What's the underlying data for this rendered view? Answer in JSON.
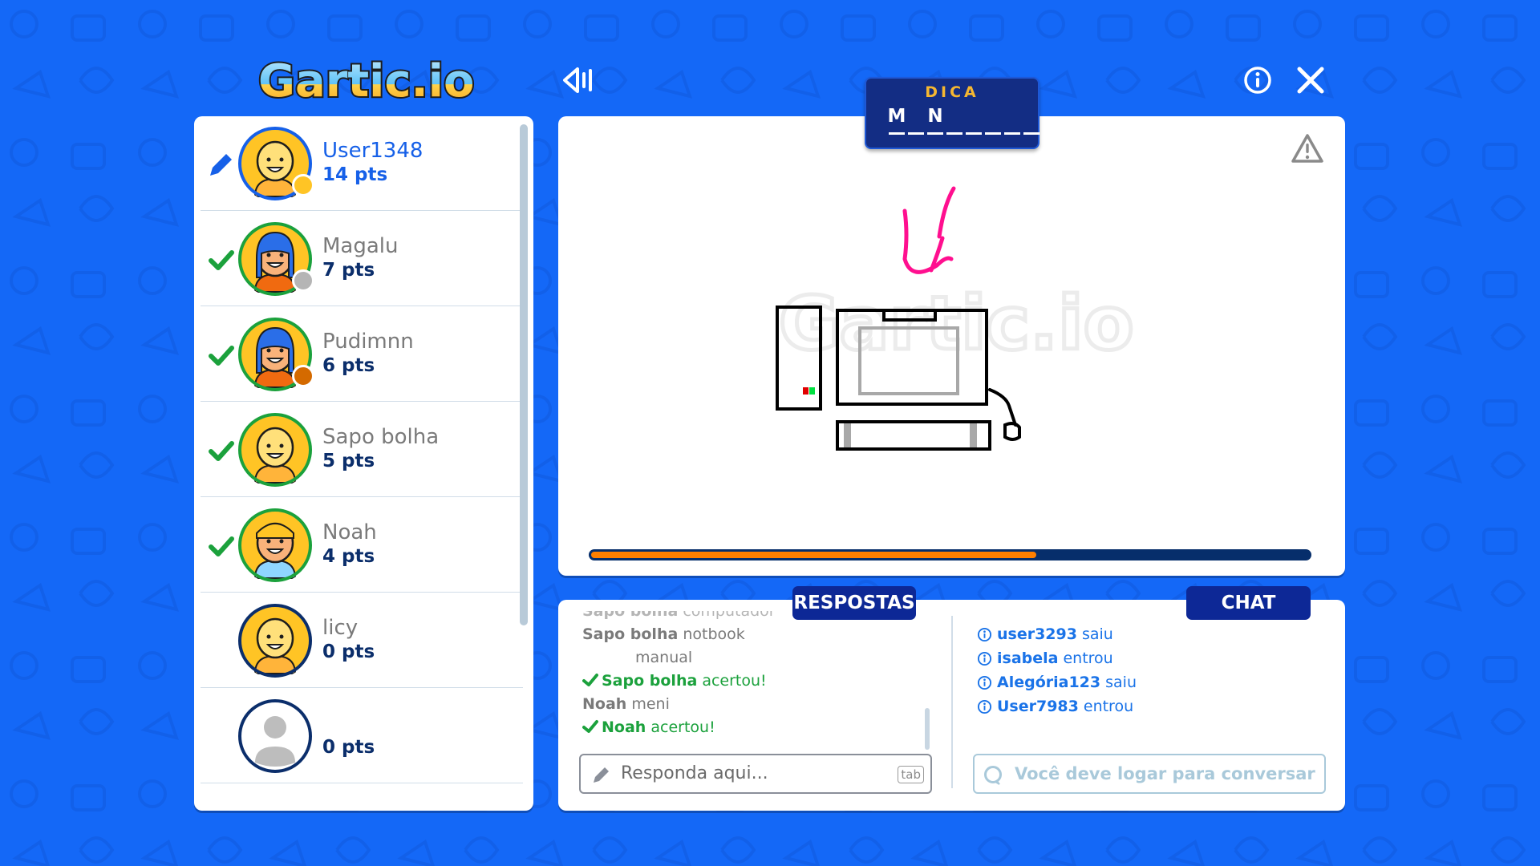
{
  "app": {
    "logo_text": "Gartic.io",
    "watermark_text": "Gartic.io"
  },
  "header": {
    "sound_icon": "speaker-icon",
    "info_icon": "info-icon",
    "close_icon": "close-icon"
  },
  "hint": {
    "title": "DICA",
    "letters": [
      "M",
      "",
      "N",
      "",
      "",
      "",
      "",
      ""
    ]
  },
  "players": [
    {
      "name": "User1348",
      "pts": "14 pts",
      "status": "drawing",
      "badge_color": "#ffc425",
      "ring_color": "#1660e8",
      "me": true
    },
    {
      "name": "Magalu",
      "pts": "7 pts",
      "status": "correct",
      "badge_color": "#b5b5b5",
      "ring_color": "#1ba13c"
    },
    {
      "name": "Pudimnn",
      "pts": "6 pts",
      "status": "correct",
      "badge_color": "#d46a00",
      "ring_color": "#1ba13c"
    },
    {
      "name": "Sapo bolha",
      "pts": "5 pts",
      "status": "correct",
      "ring_color": "#1ba13c"
    },
    {
      "name": "Noah",
      "pts": "4 pts",
      "status": "correct",
      "ring_color": "#1ba13c"
    },
    {
      "name": "licy",
      "pts": "0 pts",
      "status": "none",
      "ring_color": "#0b2e6b"
    },
    {
      "name": "",
      "pts": "0 pts",
      "status": "none",
      "ring_color": "#0b2e6b",
      "guest": true
    }
  ],
  "canvas": {
    "timer_progress": 0.62,
    "warning_icon": "warning-icon"
  },
  "answers": {
    "tab_label": "RESPOSTAS",
    "lines": [
      {
        "user": "Sapo bolha",
        "text": "computador",
        "type": "faded"
      },
      {
        "user": "Sapo bolha",
        "text": "notbook",
        "type": "guess"
      },
      {
        "user": "",
        "text": "manual",
        "type": "cont"
      },
      {
        "user": "Sapo bolha",
        "text": "acertou!",
        "type": "correct"
      },
      {
        "user": "Noah",
        "text": "meni",
        "type": "guess"
      },
      {
        "user": "Noah",
        "text": "acertou!",
        "type": "correct"
      }
    ],
    "input_placeholder": "Responda aqui...",
    "tab_key": "tab"
  },
  "chat": {
    "tab_label": "CHAT",
    "lines": [
      {
        "user": "user3293",
        "action": "saiu"
      },
      {
        "user": "isabela",
        "action": "entrou"
      },
      {
        "user": "Alegória123",
        "action": "saiu"
      },
      {
        "user": "User7983",
        "action": "entrou"
      }
    ],
    "input_placeholder": "Você deve logar para conversar"
  },
  "colors": {
    "background": "#1468f7",
    "navy": "#0d2896",
    "accent_orange": "#ff7f00",
    "success": "#1ba13c",
    "link_blue": "#1a73e8"
  }
}
